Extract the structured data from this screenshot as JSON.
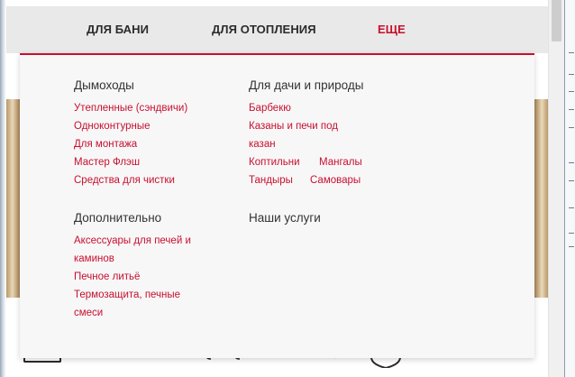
{
  "nav": {
    "items": [
      {
        "label": "ДЛЯ БАНИ",
        "active": false
      },
      {
        "label": "ДЛЯ ОТОПЛЕНИЯ",
        "active": false
      },
      {
        "label": "ЕЩЕ",
        "active": true
      }
    ]
  },
  "dropdown": {
    "col1": {
      "section1": {
        "title": "Дымоходы",
        "links": [
          "Утепленные (сэндвичи)",
          "Одноконтурные",
          "Для монтажа",
          "Мастер Флэш",
          "Средства для чистки"
        ]
      },
      "section2": {
        "title": "Дополнительно",
        "links": [
          "Аксессуары для печей и",
          "каминов",
          "Печное литьё",
          "Термозащита, печные",
          "смеси"
        ]
      }
    },
    "col2": {
      "section1": {
        "title": "Для дачи и природы",
        "links": [
          "Барбекю",
          "Казаны и печи под",
          "казан",
          "Коптильни",
          "Мангалы",
          "Тандыры",
          "Самовары"
        ]
      },
      "section2": {
        "title": "Наши услуги"
      }
    }
  },
  "colors": {
    "accent": "#c8102e",
    "nav_bg": "#e9e9e9",
    "dropdown_bg": "#f7f7f8",
    "heading_text": "#333333"
  }
}
